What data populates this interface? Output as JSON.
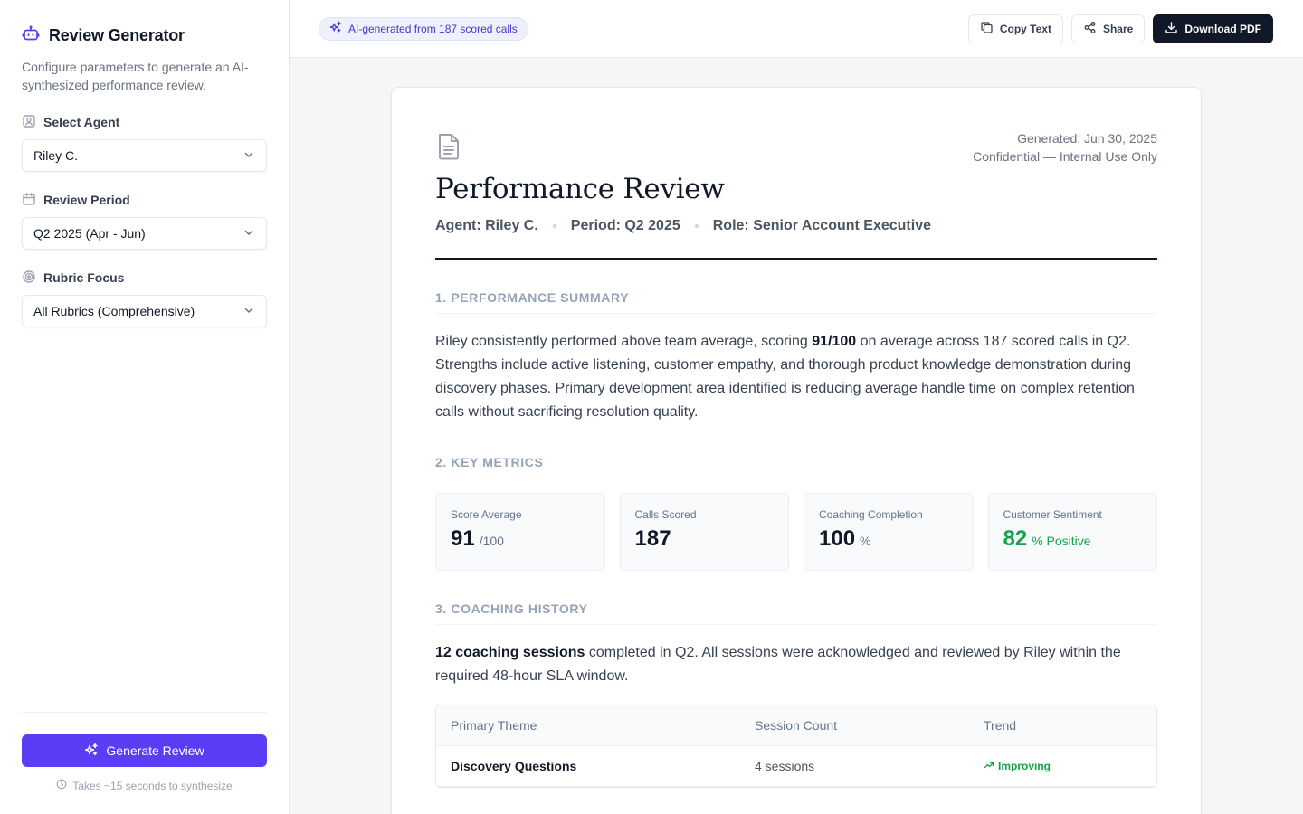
{
  "sidebar": {
    "title": "Review Generator",
    "description": "Configure parameters to generate an AI-synthesized performance review.",
    "fields": [
      {
        "label": "Select Agent",
        "value": "Riley C."
      },
      {
        "label": "Review Period",
        "value": "Q2 2025 (Apr - Jun)"
      },
      {
        "label": "Rubric Focus",
        "value": "All Rubrics (Comprehensive)"
      }
    ],
    "generate_label": "Generate Review",
    "hint": "Takes ~15 seconds to synthesize"
  },
  "topbar": {
    "ai_badge": "AI-generated from 187 scored calls",
    "copy_label": "Copy Text",
    "share_label": "Share",
    "download_label": "Download PDF"
  },
  "doc": {
    "generated": "Generated: Jun 30, 2025",
    "confidential": "Confidential — Internal Use Only",
    "title": "Performance Review",
    "agent": "Agent: Riley C.",
    "period": "Period: Q2 2025",
    "role": "Role: Senior Account Executive",
    "sections": {
      "summary_title": "1. PERFORMANCE SUMMARY",
      "summary_pre": "Riley consistently performed above team average, scoring ",
      "summary_bold": "91/100",
      "summary_post": " on average across 187 scored calls in Q2. Strengths include active listening, customer empathy, and thorough product knowledge demonstration during discovery phases. Primary development area identified is reducing average handle time on complex retention calls without sacrificing resolution quality.",
      "metrics_title": "2. KEY METRICS",
      "coaching_title": "3. COACHING HISTORY",
      "coaching_bold": "12 coaching sessions",
      "coaching_post": " completed in Q2. All sessions were acknowledged and reviewed by Riley within the required 48-hour SLA window."
    },
    "metrics": [
      {
        "label": "Score Average",
        "value": "91",
        "unit": "/100"
      },
      {
        "label": "Calls Scored",
        "value": "187",
        "unit": ""
      },
      {
        "label": "Coaching Completion",
        "value": "100",
        "unit": "%"
      },
      {
        "label": "Customer Sentiment",
        "value": "82",
        "unit": "% Positive",
        "color": "#16a34a"
      }
    ],
    "table": {
      "headers": [
        "Primary Theme",
        "Session Count",
        "Trend"
      ],
      "rows": [
        {
          "theme": "Discovery Questions",
          "count": "4 sessions",
          "trend": "Improving"
        }
      ]
    }
  },
  "colors": {
    "accent": "#5b3df5",
    "positive": "#16a34a",
    "dark": "#111827"
  }
}
